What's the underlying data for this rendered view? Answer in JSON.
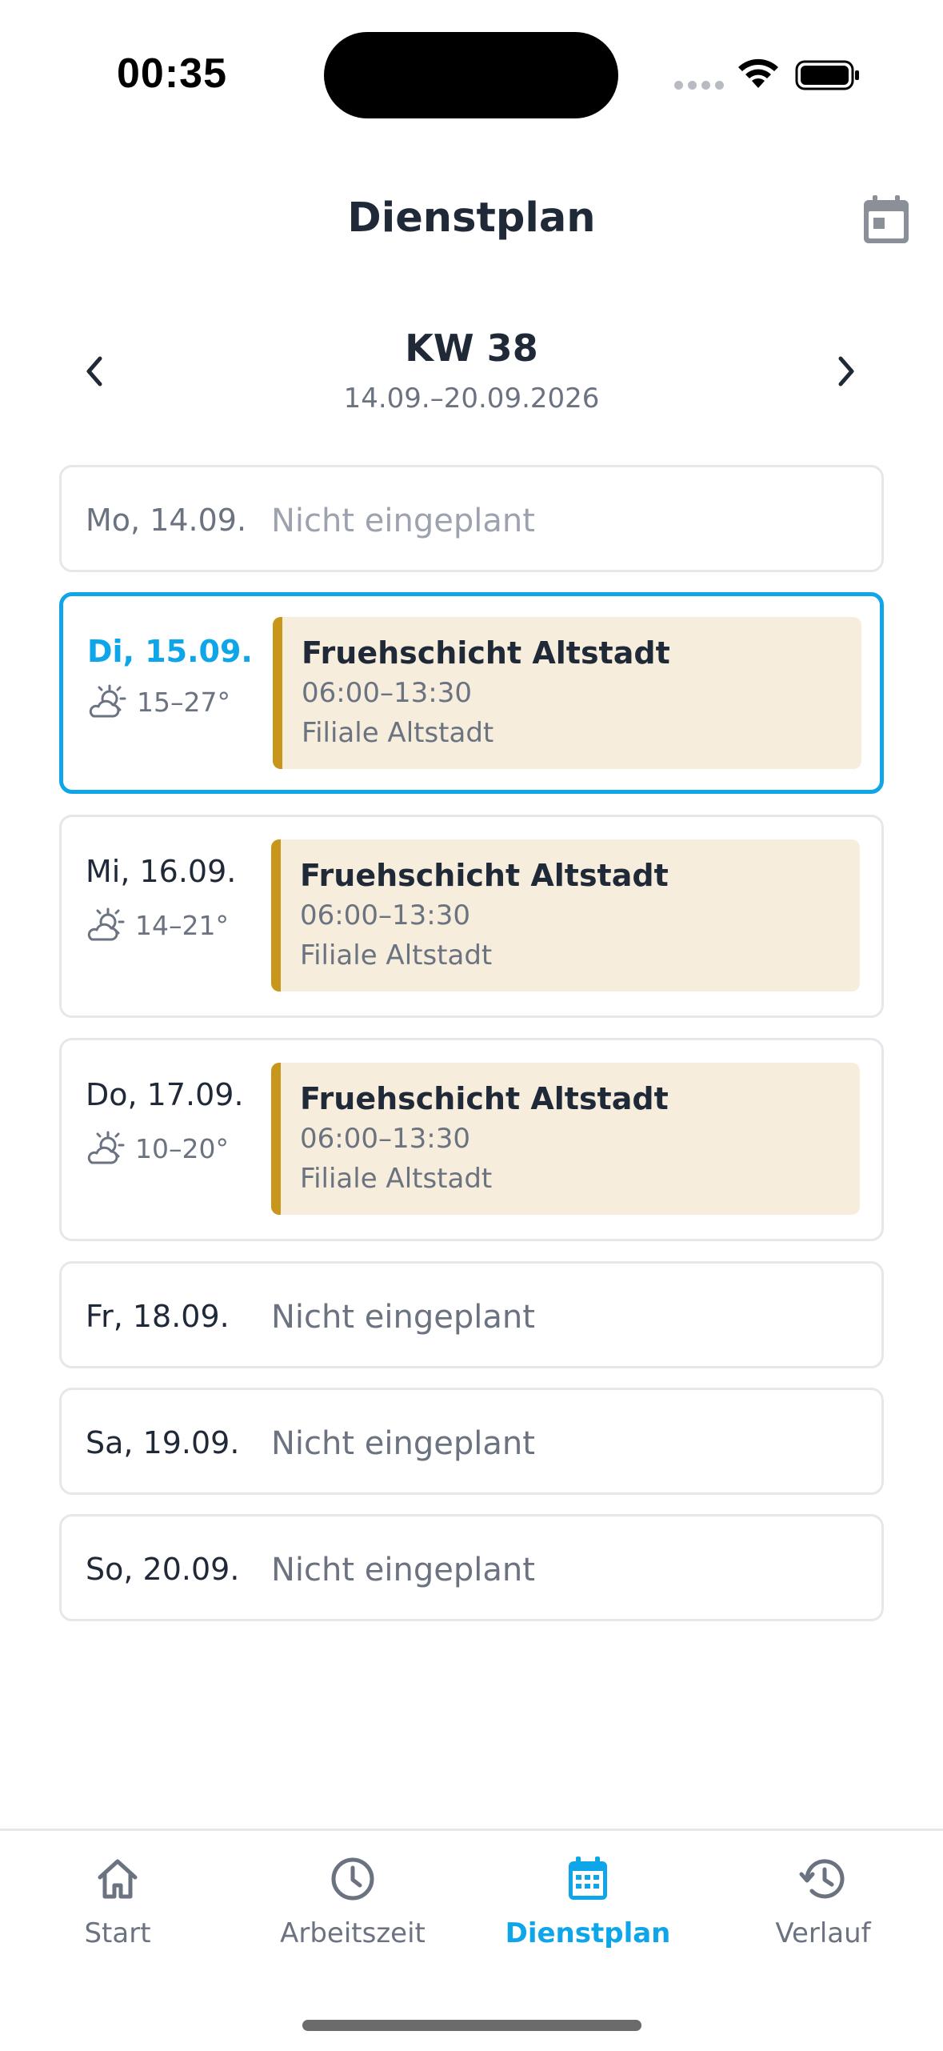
{
  "status_bar": {
    "time": "00:35"
  },
  "header": {
    "title": "Dienstplan",
    "calendar_icon": "calendar-icon"
  },
  "week_nav": {
    "week_label": "KW 38",
    "date_range": "14.09.–20.09.2026",
    "prev_icon": "chevron-left-icon",
    "next_icon": "chevron-right-icon"
  },
  "days": [
    {
      "label": "Mo, 14.09.",
      "status": "Nicht eingeplant"
    },
    {
      "label": "Di, 15.09.",
      "weather": "15–27°",
      "shift": {
        "name": "Fruehschicht Altstadt",
        "time": "06:00–13:30",
        "location": "Filiale Altstadt"
      }
    },
    {
      "label": "Mi, 16.09.",
      "weather": "14–21°",
      "shift": {
        "name": "Fruehschicht Altstadt",
        "time": "06:00–13:30",
        "location": "Filiale Altstadt"
      }
    },
    {
      "label": "Do, 17.09.",
      "weather": "10–20°",
      "shift": {
        "name": "Fruehschicht Altstadt",
        "time": "06:00–13:30",
        "location": "Filiale Altstadt"
      }
    },
    {
      "label": "Fr, 18.09.",
      "status": "Nicht eingeplant"
    },
    {
      "label": "Sa, 19.09.",
      "status": "Nicht eingeplant"
    },
    {
      "label": "So, 20.09.",
      "status": "Nicht eingeplant"
    }
  ],
  "tab_bar": {
    "tabs": [
      {
        "label": "Start",
        "icon": "home-icon"
      },
      {
        "label": "Arbeitszeit",
        "icon": "clock-icon"
      },
      {
        "label": "Dienstplan",
        "icon": "calendar-icon",
        "active": true
      },
      {
        "label": "Verlauf",
        "icon": "history-icon"
      }
    ]
  },
  "colors": {
    "accent": "#0ea5e9",
    "shift_bg": "#f6eddc",
    "shift_bar": "#c8961a",
    "text_primary": "#1f2937",
    "text_secondary": "#6b7280"
  }
}
